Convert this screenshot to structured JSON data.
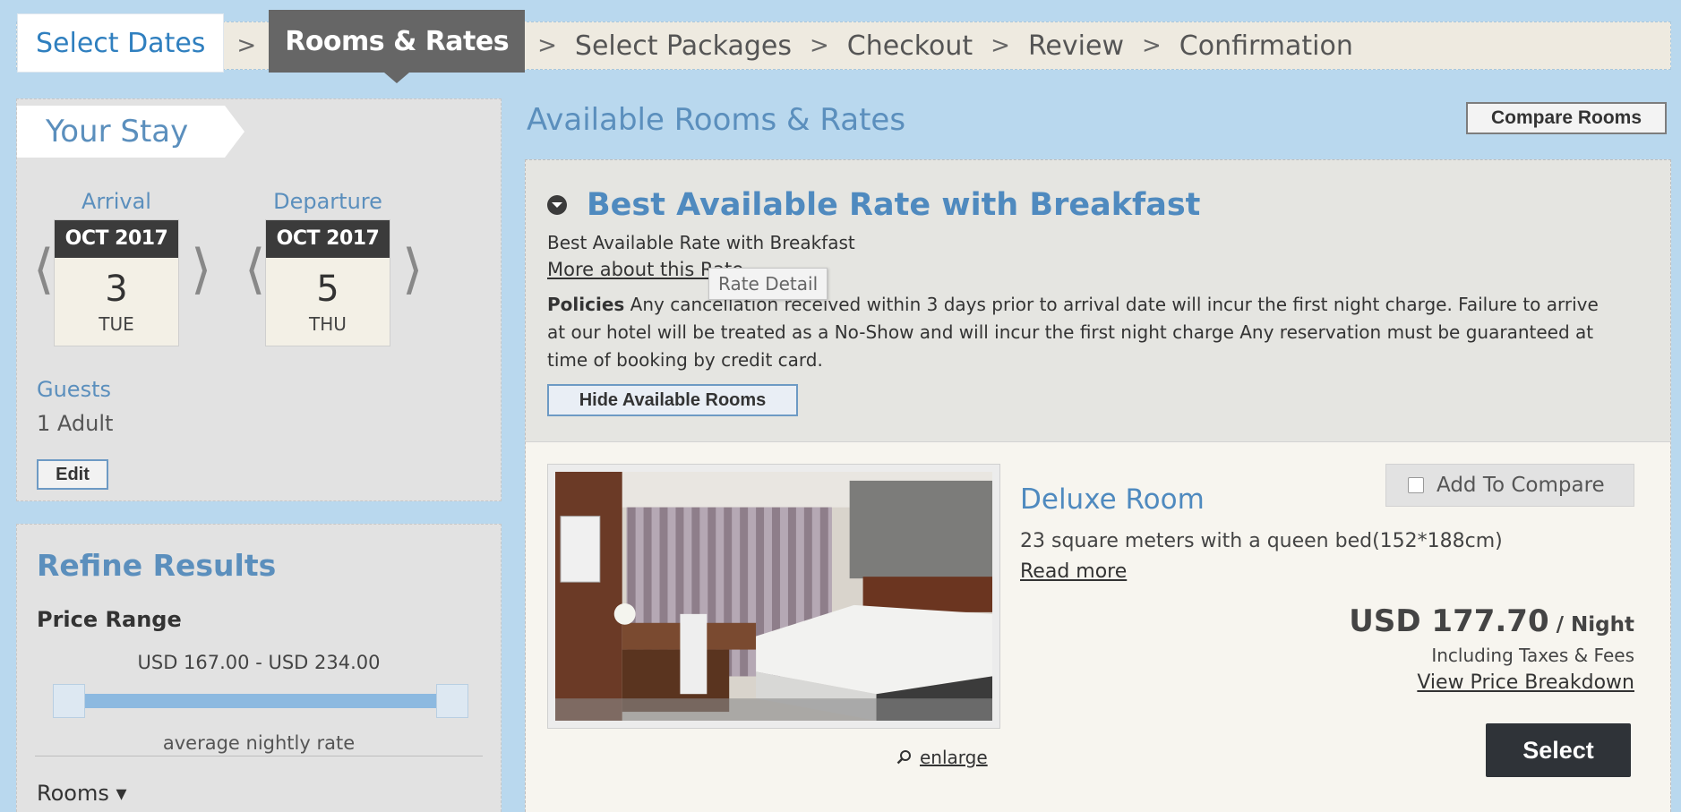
{
  "steps": {
    "select_dates": "Select Dates",
    "rooms_rates": "Rooms & Rates",
    "select_packages": "Select Packages",
    "checkout": "Checkout",
    "review": "Review",
    "confirmation": "Confirmation",
    "separator": ">"
  },
  "stay": {
    "title": "Your Stay",
    "arrival": {
      "caption": "Arrival",
      "month": "OCT 2017",
      "day": "3",
      "weekday": "TUE"
    },
    "departure": {
      "caption": "Departure",
      "month": "OCT 2017",
      "day": "5",
      "weekday": "THU"
    },
    "chev_left": "⟨",
    "chev_right": "⟩",
    "guests_label": "Guests",
    "guests_value": "1 Adult",
    "edit_label": "Edit"
  },
  "refine": {
    "title": "Refine Results",
    "price_label": "Price Range",
    "price_range": "USD 167.00 - USD 234.00",
    "avg_label": "average nightly rate",
    "rooms_label": "Rooms ▾"
  },
  "main": {
    "title": "Available Rooms & Rates",
    "compare_button": "Compare Rooms",
    "rate": {
      "title": "Best Available Rate with Breakfast",
      "subtitle": "Best Available Rate with Breakfast",
      "more_link": "More about this Rate",
      "tooltip": "Rate Detail",
      "policies_label": "Policies",
      "policies_text": " Any cancellation received within 3 days prior to arrival date will incur the first night charge. Failure to arrive at our hotel will be treated as a No-Show and will incur the first night charge Any reservation must be guaranteed at time of booking by credit card.",
      "hide_button": "Hide Available Rooms"
    },
    "room": {
      "name": "Deluxe Room",
      "description": "23 square meters with a queen bed(152*188cm)",
      "read_more": "Read more",
      "compare_label": "Add To Compare",
      "price": "USD 177.70",
      "price_unit": " / Night",
      "price_note": "Including Taxes & Fees",
      "breakdown_link": "View Price Breakdown",
      "select_button": "Select",
      "enlarge_link": "enlarge"
    }
  },
  "colors": {
    "background": "#b9d8ee",
    "accent_blue": "#4f8abf",
    "active_step": "#666666",
    "select_button": "#2f3338"
  },
  "icons": {
    "toggle": "collapse-circle-icon",
    "enlarge": "magnifier-icon",
    "checkbox": "checkbox-icon"
  }
}
